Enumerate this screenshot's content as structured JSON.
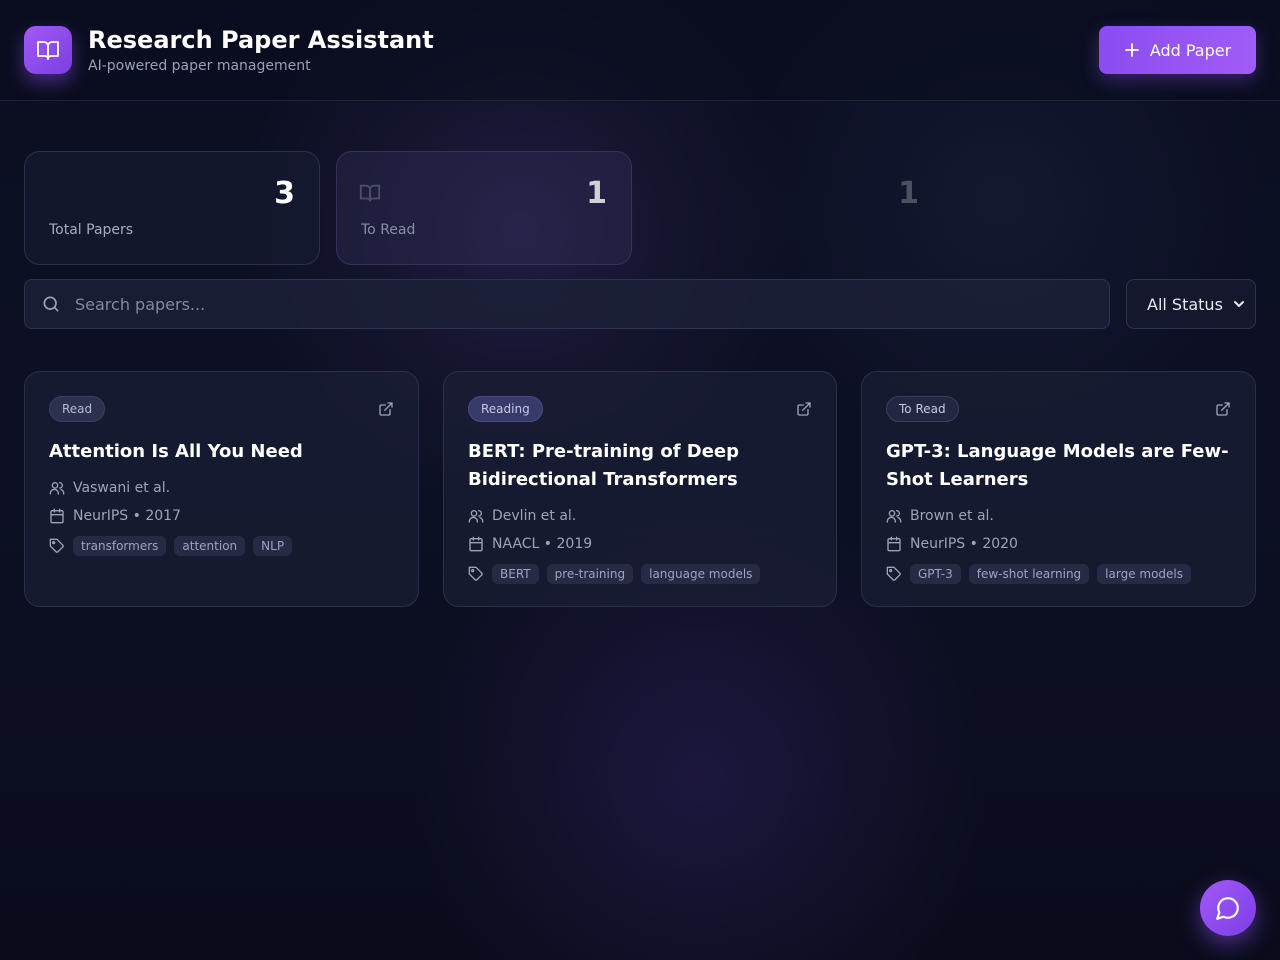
{
  "header": {
    "title": "Research Paper Assistant",
    "subtitle": "AI-powered paper management",
    "add_button_label": "Add Paper",
    "logo_icon": "book-open-icon"
  },
  "stats": [
    {
      "value": "3",
      "label": "Total Papers"
    },
    {
      "value": "1",
      "label": "To Read"
    },
    {
      "value": "1",
      "label": ""
    }
  ],
  "search": {
    "placeholder": "Search papers...",
    "value": ""
  },
  "filter": {
    "selected": "All Status"
  },
  "papers": [
    {
      "status": "Read",
      "title": "Attention Is All You Need",
      "authors": "Vaswani et al.",
      "venue_year": "NeurIPS • 2017",
      "tags": [
        "transformers",
        "attention",
        "NLP"
      ]
    },
    {
      "status": "Reading",
      "title": "BERT: Pre-training of Deep Bidirectional Transformers",
      "authors": "Devlin et al.",
      "venue_year": "NAACL • 2019",
      "tags": [
        "BERT",
        "pre-training",
        "language models"
      ]
    },
    {
      "status": "To Read",
      "title": "GPT-3: Language Models are Few-Shot Learners",
      "authors": "Brown et al.",
      "venue_year": "NeurIPS • 2020",
      "tags": [
        "GPT-3",
        "few-shot learning",
        "large models"
      ]
    }
  ],
  "colors": {
    "accent": "#9b55f4",
    "background": "#0b0e1f",
    "card": "#1a1e34"
  }
}
